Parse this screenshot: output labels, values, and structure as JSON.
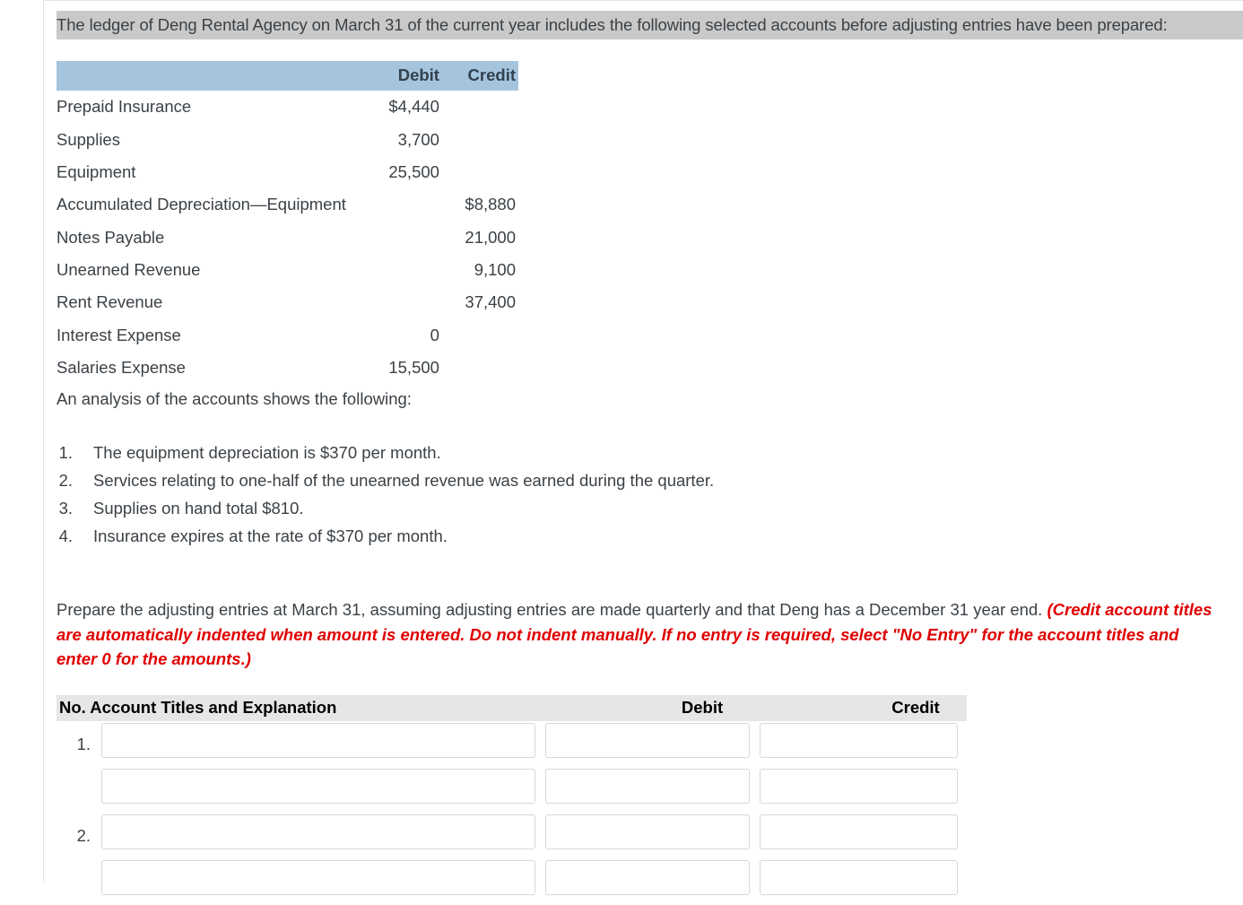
{
  "intro": {
    "text": "The ledger of Deng Rental Agency on March 31 of the current year includes the following selected accounts before adjusting entries have been prepared:"
  },
  "ledger": {
    "columns": [
      "",
      "Debit",
      "Credit"
    ],
    "rows": [
      {
        "account": "Prepaid Insurance",
        "debit": "$4,440",
        "credit": ""
      },
      {
        "account": "Supplies",
        "debit": "3,700",
        "credit": ""
      },
      {
        "account": "Equipment",
        "debit": "25,500",
        "credit": ""
      },
      {
        "account": "Accumulated Depreciation—Equipment",
        "debit": "",
        "credit": "$8,880"
      },
      {
        "account": "Notes Payable",
        "debit": "",
        "credit": "21,000"
      },
      {
        "account": "Unearned Revenue",
        "debit": "",
        "credit": "9,100"
      },
      {
        "account": "Rent Revenue",
        "debit": "",
        "credit": "37,400"
      },
      {
        "account": "Interest Expense",
        "debit": "0",
        "credit": ""
      },
      {
        "account": "Salaries Expense",
        "debit": "15,500",
        "credit": ""
      }
    ]
  },
  "analysis": {
    "intro": "An analysis of the accounts shows the following:",
    "items": [
      {
        "num": "1.",
        "text": "The equipment depreciation is $370 per month."
      },
      {
        "num": "2.",
        "text": "Services relating to one-half of the unearned revenue was earned during the quarter."
      },
      {
        "num": "3.",
        "text": "Supplies on hand total $810."
      },
      {
        "num": "4.",
        "text": "Insurance expires at the rate of $370 per month."
      }
    ]
  },
  "prepare": {
    "main": "Prepare the adjusting entries at March 31, assuming adjusting entries are made quarterly and that Deng has a December 31 year end. ",
    "hint": "(Credit account titles are automatically indented when amount is entered. Do not indent manually. If no entry is required, select \"No Entry\" for the account titles and enter 0 for the amounts.)",
    "hint_color": "#e00000"
  },
  "journal": {
    "header": {
      "titles": "No. Account Titles and Explanation",
      "debit": "Debit",
      "credit": "Credit"
    },
    "rows": [
      {
        "num": "1.",
        "title": "",
        "debit": "",
        "credit": "",
        "placeholder": ""
      },
      {
        "num": "",
        "title": "",
        "debit": "",
        "credit": "",
        "placeholder": ""
      },
      {
        "num": "2.",
        "title": "",
        "debit": "",
        "credit": "",
        "placeholder": ""
      },
      {
        "num": "",
        "title": "",
        "debit": "",
        "credit": "",
        "placeholder": ""
      }
    ]
  },
  "colors": {
    "ledger_header_bg": "#a5c5de",
    "intro_highlight_bg": "#c9c9c9",
    "journal_header_bg": "#e6e6e6",
    "text": "#3b4146",
    "hint_red": "#e00000"
  }
}
